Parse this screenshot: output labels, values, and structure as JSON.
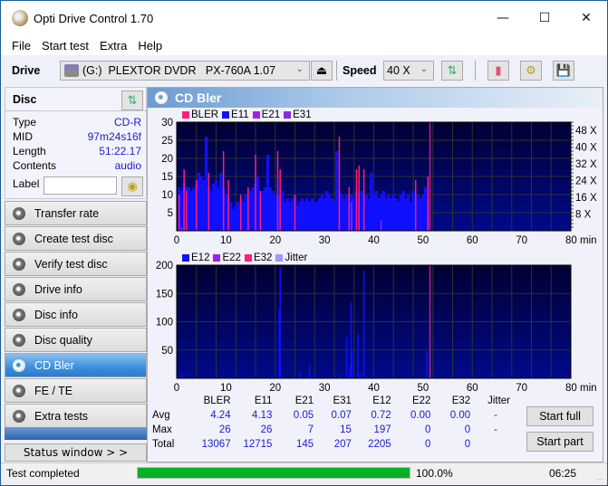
{
  "window": {
    "title": "Opti Drive Control 1.70",
    "minimize": "—",
    "maximize": "☐",
    "close": "✕"
  },
  "menu": [
    "File",
    "Start test",
    "Extra",
    "Help"
  ],
  "toolbar": {
    "drive_label": "Drive",
    "drive_value": "(G:)  PLEXTOR DVDR   PX-760A 1.07",
    "speed_label": "Speed",
    "speed_value": "40 X"
  },
  "disc": {
    "header": "Disc",
    "type_label": "Type",
    "type_value": "CD-R",
    "mid_label": "MID",
    "mid_value": "97m24s16f",
    "length_label": "Length",
    "length_value": "51:22.17",
    "contents_label": "Contents",
    "contents_value": "audio",
    "label_label": "Label",
    "label_value": ""
  },
  "nav": [
    {
      "label": "Transfer rate",
      "active": false
    },
    {
      "label": "Create test disc",
      "active": false
    },
    {
      "label": "Verify test disc",
      "active": false
    },
    {
      "label": "Drive info",
      "active": false
    },
    {
      "label": "Disc info",
      "active": false
    },
    {
      "label": "Disc quality",
      "active": false
    },
    {
      "label": "CD Bler",
      "active": true
    },
    {
      "label": "FE / TE",
      "active": false
    },
    {
      "label": "Extra tests",
      "active": false
    }
  ],
  "status_window_btn": "Status window > >",
  "panel_title": "CD Bler",
  "colors": {
    "BLER": "#ff1e78",
    "E11": "#1010ff",
    "E21": "#a020f0",
    "E31": "#8a2be2",
    "E12": "#1010ff",
    "E22": "#a020f0",
    "E32": "#ff1e78",
    "Jitter": "#9a9aff",
    "end_marker": "#c0208a",
    "progress": "#06b025"
  },
  "chart_data": [
    {
      "type": "bar",
      "title": "CD Bler upper",
      "legend": [
        "BLER",
        "E11",
        "E21",
        "E31"
      ],
      "xlabel": "min",
      "xlim": [
        0,
        80
      ],
      "ylim": [
        0,
        30
      ],
      "x_ticks": [
        "0",
        "10",
        "20",
        "30",
        "40",
        "50",
        "60",
        "70",
        "80 min"
      ],
      "y_ticks": [
        "5",
        "10",
        "15",
        "20",
        "25",
        "30"
      ],
      "y2_ticks": [
        "8 X",
        "16 X",
        "24 X",
        "32 X",
        "40 X",
        "48 X"
      ],
      "end_marker_min": 51.4,
      "series": [
        {
          "name": "E11",
          "x": [
            0.5,
            1,
            1.5,
            2,
            2.5,
            3,
            3.5,
            4,
            4.5,
            5,
            5.5,
            6,
            6.5,
            7,
            7.5,
            8,
            8.5,
            9,
            9.5,
            10,
            10.5,
            11,
            11.5,
            12,
            12.5,
            13,
            13.5,
            14,
            14.5,
            15,
            15.5,
            16,
            16.5,
            17,
            17.5,
            18,
            18.5,
            19,
            19.5,
            20,
            20.5,
            21,
            21.5,
            22,
            22.5,
            23,
            23.5,
            24,
            24.5,
            25,
            25.5,
            26,
            26.5,
            27,
            27.5,
            28,
            28.5,
            29,
            29.5,
            30,
            30.5,
            31,
            31.5,
            32,
            32.5,
            33,
            33.5,
            34,
            34.5,
            35,
            35.5,
            36,
            36.5,
            37,
            37.5,
            38,
            38.5,
            39,
            39.5,
            40,
            40.5,
            41,
            41.5,
            42,
            42.5,
            43,
            43.5,
            44,
            44.5,
            45,
            45.5,
            46,
            46.5,
            47,
            47.5,
            48,
            48.5,
            49,
            49.5,
            50,
            50.5,
            51
          ],
          "values": [
            12,
            11,
            13,
            12,
            12,
            11,
            12,
            13,
            16,
            15,
            14,
            26,
            12,
            11,
            13,
            14,
            12,
            16,
            12,
            10,
            9,
            8,
            6,
            7,
            8,
            9,
            8,
            10,
            9,
            11,
            12,
            13,
            15,
            10,
            11,
            12,
            21,
            12,
            11,
            10,
            9,
            10,
            11,
            8,
            9,
            8,
            9,
            10,
            7,
            8,
            9,
            8,
            9,
            8,
            9,
            8,
            8,
            9,
            10,
            9,
            11,
            10,
            9,
            8,
            22,
            11,
            10,
            9,
            10,
            8,
            10,
            9,
            11,
            10,
            11,
            9,
            10,
            9,
            16,
            10,
            11,
            9,
            10,
            11,
            9,
            10,
            9,
            10,
            9,
            8,
            10,
            11,
            9,
            10,
            8,
            11,
            9,
            10,
            9,
            10,
            12,
            9
          ]
        },
        {
          "name": "BLER",
          "x": [
            0.5,
            1.5,
            2,
            4,
            6.5,
            9.5,
            10.5,
            13,
            14.5,
            16,
            17,
            20.5,
            21,
            24,
            33,
            35,
            36.5,
            37,
            38,
            48.5,
            51
          ],
          "values": [
            10,
            17,
            11,
            14,
            16,
            22,
            14,
            10,
            12,
            21,
            11,
            22,
            17,
            10,
            26,
            12,
            17,
            18,
            17,
            14,
            15
          ]
        },
        {
          "name": "E21",
          "x": [
            1,
            4,
            20.5,
            35.5
          ],
          "values": [
            1,
            1,
            7,
            5
          ]
        },
        {
          "name": "E31",
          "x": [
            20.5,
            35.5,
            41.5
          ],
          "values": [
            15,
            8,
            3
          ]
        }
      ]
    },
    {
      "type": "bar",
      "title": "CD Bler lower",
      "legend": [
        "E12",
        "E22",
        "E32",
        "Jitter"
      ],
      "xlabel": "min",
      "xlim": [
        0,
        80
      ],
      "ylim": [
        0,
        200
      ],
      "x_ticks": [
        "0",
        "10",
        "20",
        "30",
        "40",
        "50",
        "60",
        "70",
        "80 min"
      ],
      "y_ticks": [
        "50",
        "100",
        "150",
        "200"
      ],
      "end_marker_min": 51.4,
      "series": [
        {
          "name": "E12",
          "x": [
            1,
            20.8,
            21,
            25,
            27,
            28,
            33,
            34.5,
            35.2,
            35.4,
            35.6,
            36.8,
            37.2,
            38,
            50.8
          ],
          "values": [
            8,
            123,
            197,
            10,
            22,
            5,
            6,
            73,
            22,
            134,
            48,
            78,
            9,
            190,
            47
          ]
        },
        {
          "name": "E22",
          "x": [],
          "values": []
        },
        {
          "name": "E32",
          "x": [],
          "values": []
        }
      ]
    }
  ],
  "stats": {
    "columns": [
      "BLER",
      "E11",
      "E21",
      "E31",
      "E12",
      "E22",
      "E32",
      "Jitter"
    ],
    "rows": [
      {
        "label": "Avg",
        "values": [
          "4.24",
          "4.13",
          "0.05",
          "0.07",
          "0.72",
          "0.00",
          "0.00",
          "-"
        ]
      },
      {
        "label": "Max",
        "values": [
          "26",
          "26",
          "7",
          "15",
          "197",
          "0",
          "0",
          "-"
        ]
      },
      {
        "label": "Total",
        "values": [
          "13067",
          "12715",
          "145",
          "207",
          "2205",
          "0",
          "0",
          ""
        ]
      }
    ]
  },
  "buttons": {
    "start_full": "Start full",
    "start_part": "Start part"
  },
  "statusbar": {
    "text": "Test completed",
    "progress": 100.0,
    "progress_text": "100.0%",
    "time": "06:25"
  }
}
